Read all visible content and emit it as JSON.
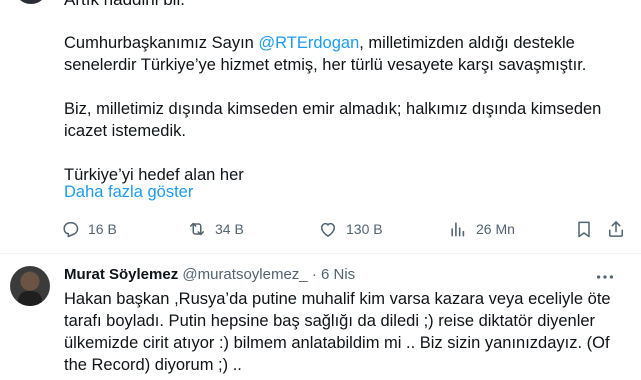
{
  "tweet": {
    "cut_line": "Artık haddini bil.",
    "para1_before": "Cumhurbaşkanımız Sayın ",
    "mention": "@RTErdogan",
    "para1_after": ", milletimizden aldığı destekle senelerdir Türkiye’ye hizmet etmiş, her türlü vesayete karşı savaşmıştır.",
    "para2": "Biz, milletimiz dışında kimseden emir almadık; halkımız dışında kimseden icazet istemedik.",
    "para3": "Türkiye’yi hedef alan her",
    "show_more": "Daha fazla göster",
    "actions": {
      "replies": "16 B",
      "reposts": "34 B",
      "likes": "130 B",
      "views": "26 Mn"
    }
  },
  "reply": {
    "name": "Murat Söylemez",
    "handle": "@muratsoylemez_",
    "separator": "·",
    "date": "6 Nis",
    "text": "Hakan başkan ,Rusya’da putine muhalif kim varsa kazara veya eceliyle öte tarafı boyladı. Putin hepsine baş sağlığı da diledi ;) reise diktatör diyenler ülkemizde cirit atıyor   :) bilmem anlatabildim mi .. Biz sizin yanınızdayız. (Of the Record) diyorum   ;) .."
  },
  "colors": {
    "accent": "#1d9bf0",
    "secondary_text": "#536471",
    "primary_text": "#0f1419"
  },
  "icons": [
    "reply-icon",
    "repost-icon",
    "like-icon",
    "views-icon",
    "bookmark-icon",
    "share-icon",
    "more-icon"
  ]
}
